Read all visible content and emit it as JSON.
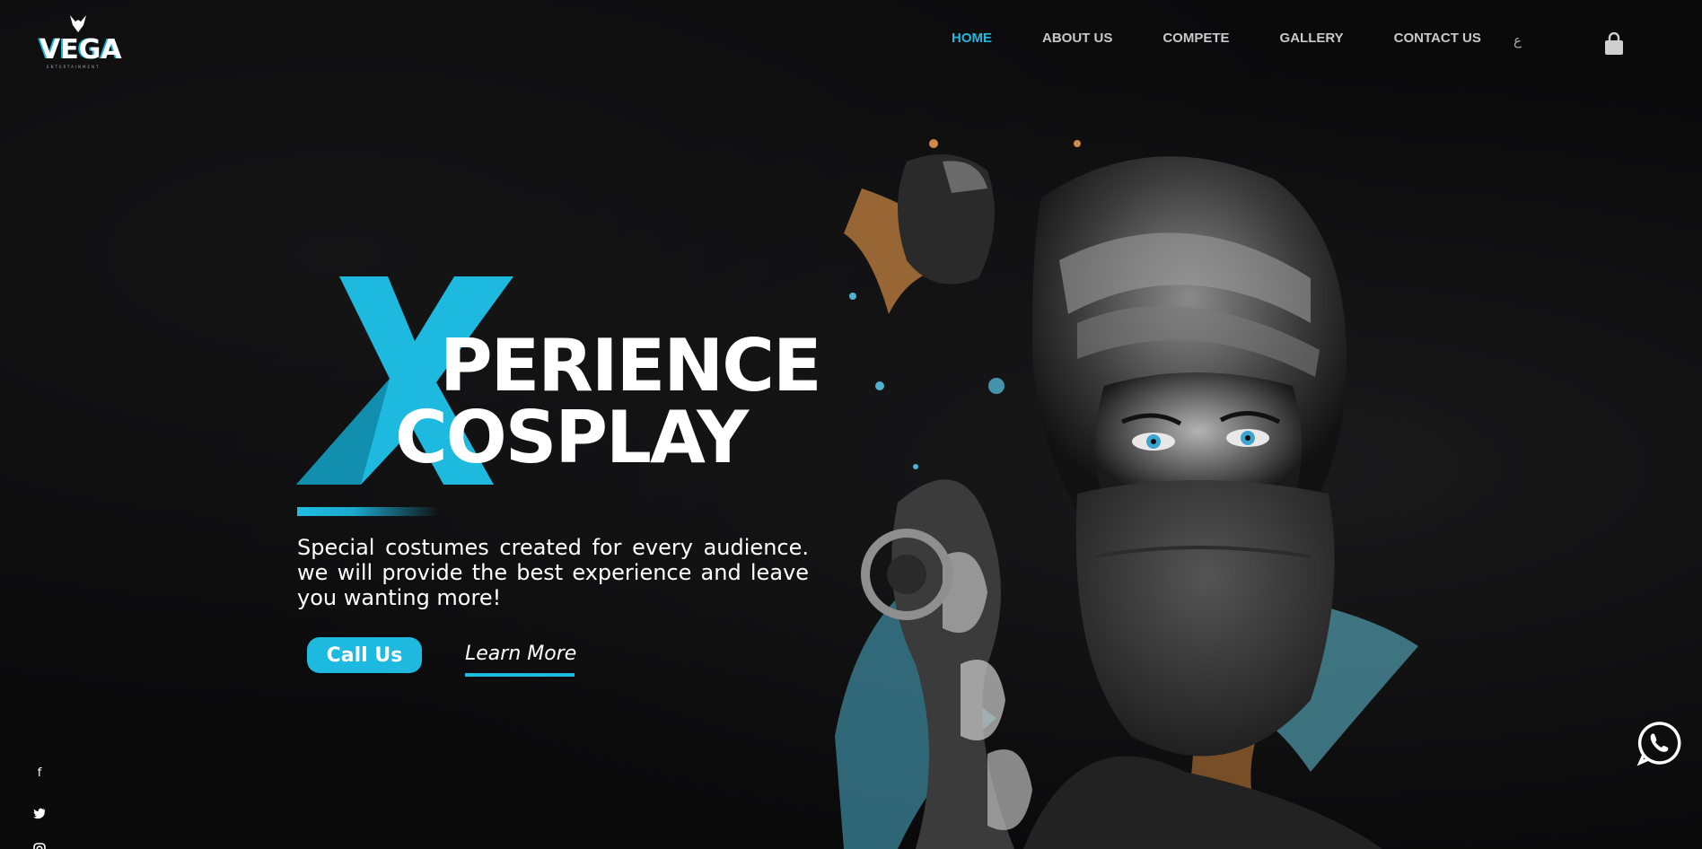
{
  "brand": {
    "name": "VEGA",
    "tagline": "ENTERTAINMENT",
    "accent_color": "#1db9df"
  },
  "nav": {
    "items": [
      {
        "label": "HOME",
        "active": true
      },
      {
        "label": "ABOUT US",
        "active": false
      },
      {
        "label": "COMPETE",
        "active": false
      },
      {
        "label": "GALLERY",
        "active": false
      },
      {
        "label": "CONTACT US",
        "active": false
      }
    ],
    "language_toggle": "ع",
    "cart_icon": "shopping-bag-icon"
  },
  "hero": {
    "title_letter": "X",
    "title_line1": "PERIENCE",
    "title_line2": "COSPLAY",
    "description": "Special costumes created for every audience. we will provide the best experience and leave you wanting more!",
    "primary_button": "Call Us",
    "secondary_button": "Learn More"
  },
  "social": {
    "icons": [
      "facebook-icon",
      "twitter-icon",
      "instagram-icon"
    ],
    "facebook": "f"
  },
  "floating": {
    "whatsapp_icon": "whatsapp-icon"
  }
}
